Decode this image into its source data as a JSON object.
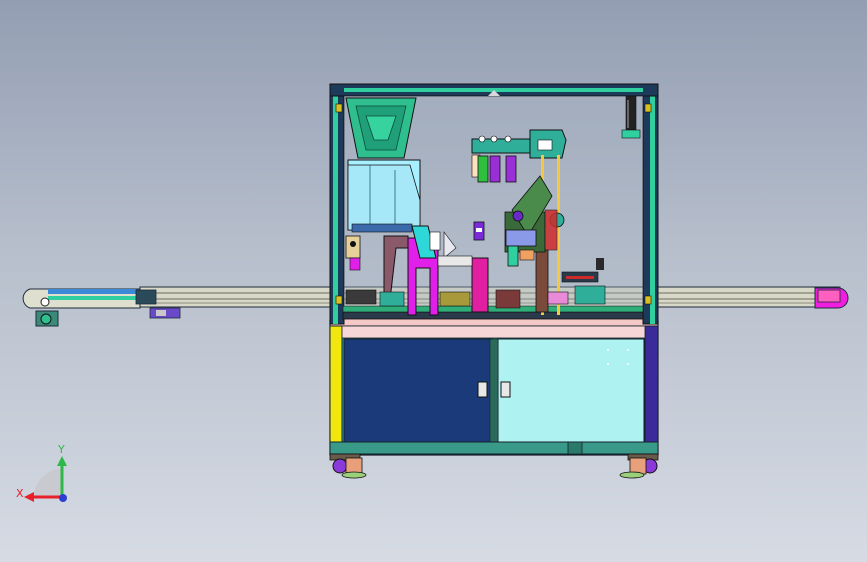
{
  "scene": {
    "background_top": "#939eb3",
    "background_bottom": "#d6dbe4"
  },
  "triad": {
    "x_label": "X",
    "y_label": "Y",
    "x_color": "#e8202a",
    "y_color": "#2fb84a",
    "z_color": "#2a3fcf"
  },
  "model": {
    "frame_color": "#2fae9a",
    "conveyor_color": "#d8d8c8",
    "left_door_color": "#1a3a7a",
    "right_door_color": "#aef2f2",
    "side_panel_color": "#f2e60f",
    "side_panel_right_color": "#3a2a9a",
    "hopper_color": "#2fbf8f"
  }
}
